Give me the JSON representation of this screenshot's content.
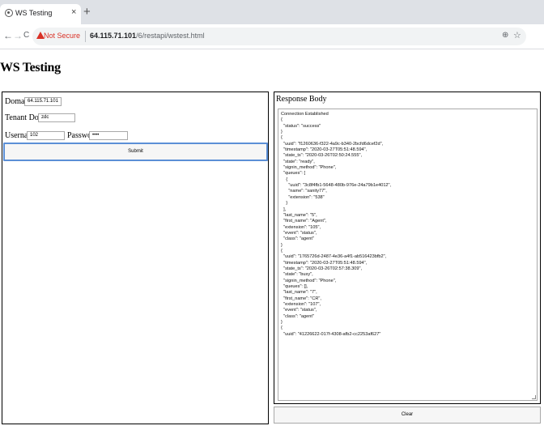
{
  "browser": {
    "tab_title": "WS Testing",
    "tab_close": "×",
    "new_tab": "+",
    "nav_back": "←",
    "nav_forward": "→",
    "nav_reload": "C",
    "security_label": "Not Secure",
    "url_host": "64.115.71.101",
    "url_path": "/6/restapi/wstest.html",
    "zoom_icon": "⊕",
    "star_icon": "☆",
    "warn_color": "#d93025"
  },
  "page": {
    "title": "WS Testing"
  },
  "form": {
    "domain_label": "Domain:",
    "domain_value": "64.115.71.101",
    "tenant_label": "Tenant Domain:",
    "tenant_value": "zdc",
    "username_label": "Username:",
    "username_value": "102",
    "password_label": "Password:",
    "password_value": "••••",
    "submit_label": "Submit",
    "submit_border_color": "#5b8fd6"
  },
  "response": {
    "label": "Response Body",
    "lines": [
      "Connection Established",
      "{",
      "  \"status\": \"success\"",
      "}",
      "{",
      "  \"uuid\": \"f1260636-f322-4a9c-b340-2bcfd6dcef2d\",",
      "  \"timestamp\": \"2020-03-27T05:51:48.594\",",
      "  \"state_ts\": \"2020-03-26T02:50:24.555\",",
      "  \"state\": \"ready\",",
      "  \"signin_method\": \"Phone\",",
      "  \"queues\": [",
      "    {",
      "      \"uuid\": \"3c8f4fb1-5648-480b-976e-24a79b1e4012\",",
      "      \"name\": \"sanity77\",",
      "      \"extension\": \"538\"",
      "    }",
      "  ],",
      "  \"last_name\": \"5\",",
      "  \"first_name\": \"Agent\",",
      "  \"extension\": \"105\",",
      "  \"event\": \"status\",",
      "  \"class\": \"agent\"",
      "}",
      "{",
      "  \"uuid\": \"1765726d-2487-4e36-a4f1-ab516423bfb2\",",
      "  \"timestamp\": \"2020-03-27T05:51:48.594\",",
      "  \"state_ts\": \"2020-03-26T02:57:38.309\",",
      "  \"state\": \"busy\",",
      "  \"signin_method\": \"Phone\",",
      "  \"queues\": [],",
      "  \"last_name\": \"7\",",
      "  \"first_name\": \"CR\",",
      "  \"extension\": \"107\",",
      "  \"event\": \"status\",",
      "  \"class\": \"agent\"",
      "}",
      "{",
      "  \"uuid\": \"41226622-017f-4308-afb2-cc2253af627\""
    ],
    "clear_label": "Clear"
  }
}
